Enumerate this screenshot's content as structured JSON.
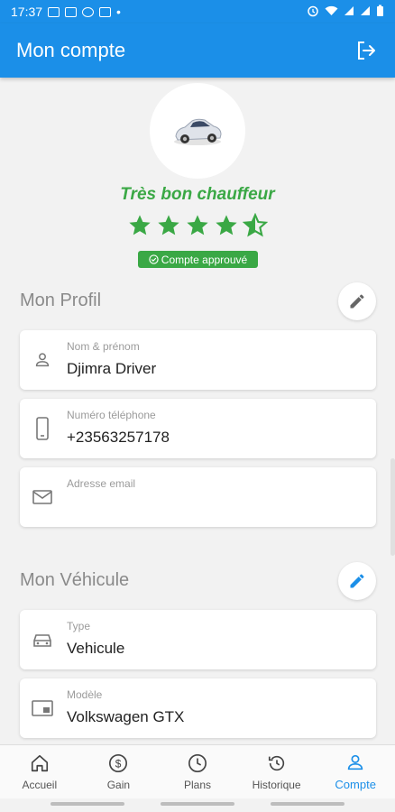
{
  "status_bar": {
    "time": "17:37",
    "dot": "•"
  },
  "app_bar": {
    "title": "Mon compte",
    "logout_icon": "logout-icon"
  },
  "profile_header": {
    "rating_label": "Très bon chauffeur",
    "rating": 4.5,
    "rating_max": 5,
    "badge": "Compte approuvé",
    "star_color": "#3aa845"
  },
  "profile_section": {
    "title": "Mon Profil",
    "fields": [
      {
        "label": "Nom & prénom",
        "value": "Djimra Driver",
        "icon": "person-icon"
      },
      {
        "label": "Numéro téléphone",
        "value": "+23563257178",
        "icon": "phone-icon"
      },
      {
        "label": "Adresse email",
        "value": "",
        "icon": "email-icon"
      }
    ]
  },
  "vehicle_section": {
    "title": "Mon Véhicule",
    "fields": [
      {
        "label": "Type",
        "value": "Vehicule",
        "icon": "car-icon"
      },
      {
        "label": "Modèle",
        "value": "Volkswagen GTX",
        "icon": "card-icon"
      }
    ]
  },
  "bottom_nav": [
    {
      "label": "Accueil",
      "icon": "home-icon"
    },
    {
      "label": "Gain",
      "icon": "dollar-icon"
    },
    {
      "label": "Plans",
      "icon": "clock-icon"
    },
    {
      "label": "Historique",
      "icon": "history-icon"
    },
    {
      "label": "Compte",
      "icon": "account-icon",
      "active": true
    }
  ],
  "colors": {
    "primary": "#1b8fe8",
    "success": "#3aa845",
    "background": "#f2f2f2"
  }
}
